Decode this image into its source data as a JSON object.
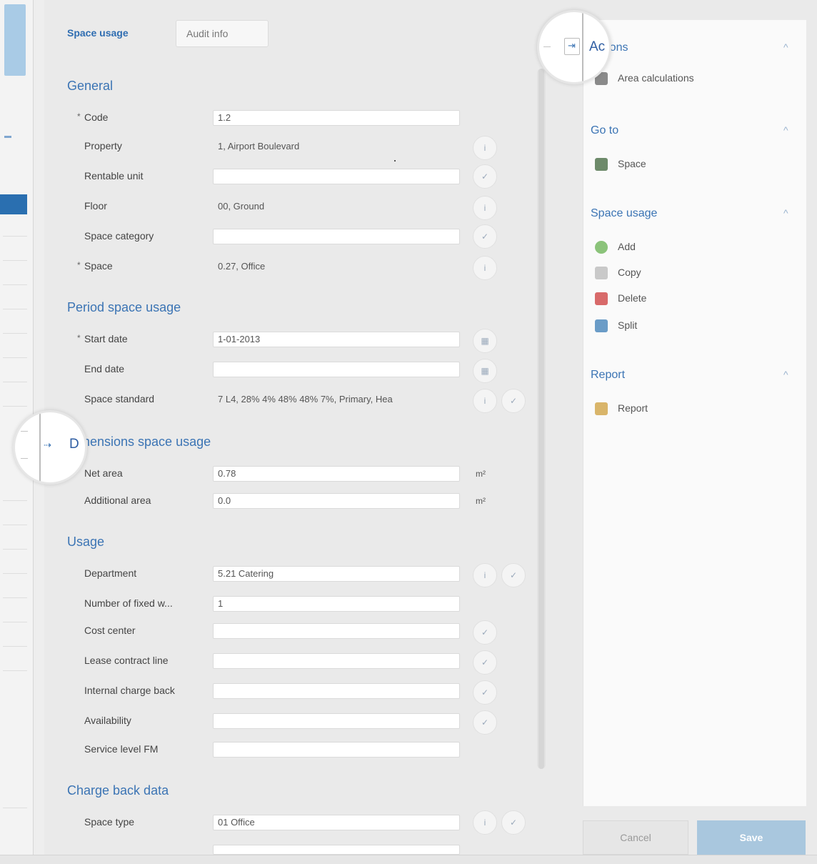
{
  "tabs": [
    "Space usage",
    "Audit info"
  ],
  "sections": {
    "general": {
      "title": "General",
      "fields": [
        {
          "label": "Code",
          "value": "1.2",
          "required": true
        },
        {
          "label": "Property",
          "value": "1, Airport Boulevard",
          "required": false
        },
        {
          "label": "Rentable unit",
          "value": "",
          "required": false
        },
        {
          "label": "Floor",
          "value": "00, Ground",
          "required": false
        },
        {
          "label": "Space category",
          "value": "",
          "required": false
        },
        {
          "label": "Space",
          "value": "0.27, Office",
          "required": true
        }
      ]
    },
    "period": {
      "title": "Period space usage",
      "fields": [
        {
          "label": "Start date",
          "value": "1-01-2013",
          "required": true
        },
        {
          "label": "End date",
          "value": "",
          "required": false
        },
        {
          "label": "Space standard",
          "value": "7 L4, 28% 4% 48% 48% 7%, Primary, Hea",
          "required": false
        }
      ]
    },
    "dimensions": {
      "title": "Dimensions space usage",
      "fields": [
        {
          "label": "Net area",
          "value": "0.78",
          "unit": "m²"
        },
        {
          "label": "Additional area",
          "value": "0.0",
          "unit": "m²"
        }
      ]
    },
    "usage": {
      "title": "Usage",
      "fields": [
        {
          "label": "Department",
          "value": "5.21 Catering"
        },
        {
          "label": "Number of fixed w...",
          "value": "1"
        },
        {
          "label": "Cost center",
          "value": ""
        },
        {
          "label": "Lease contract line",
          "value": ""
        },
        {
          "label": "Internal charge back",
          "value": ""
        },
        {
          "label": "Availability",
          "value": ""
        },
        {
          "label": "Service level FM",
          "value": ""
        }
      ]
    },
    "charge": {
      "title": "Charge back data",
      "fields": [
        {
          "label": "Space type",
          "value": "01 Office"
        }
      ]
    }
  },
  "panel": {
    "groups": [
      {
        "title": "Actions",
        "items": [
          {
            "label": "Area calculations",
            "icon": "area-calc-icon",
            "color": "#8a8a8a"
          }
        ]
      },
      {
        "title": "Go to",
        "items": [
          {
            "label": "Space",
            "icon": "space-icon",
            "color": "#6d8a6a"
          }
        ]
      },
      {
        "title": "Space usage",
        "items": [
          {
            "label": "Add",
            "icon": "add-icon",
            "color": "#8bc37a"
          },
          {
            "label": "Copy",
            "icon": "copy-icon",
            "color": "#c9c9c9"
          },
          {
            "label": "Delete",
            "icon": "delete-icon",
            "color": "#d86a6a"
          },
          {
            "label": "Split",
            "icon": "split-icon",
            "color": "#6a9cc7"
          }
        ]
      },
      {
        "title": "Report",
        "items": [
          {
            "label": "Report",
            "icon": "report-icon",
            "color": "#d9b56a"
          }
        ]
      }
    ],
    "cancel_label": "Cancel",
    "save_label": "Save"
  },
  "magnifier": {
    "top_text": "Ac",
    "left_text": "D"
  }
}
